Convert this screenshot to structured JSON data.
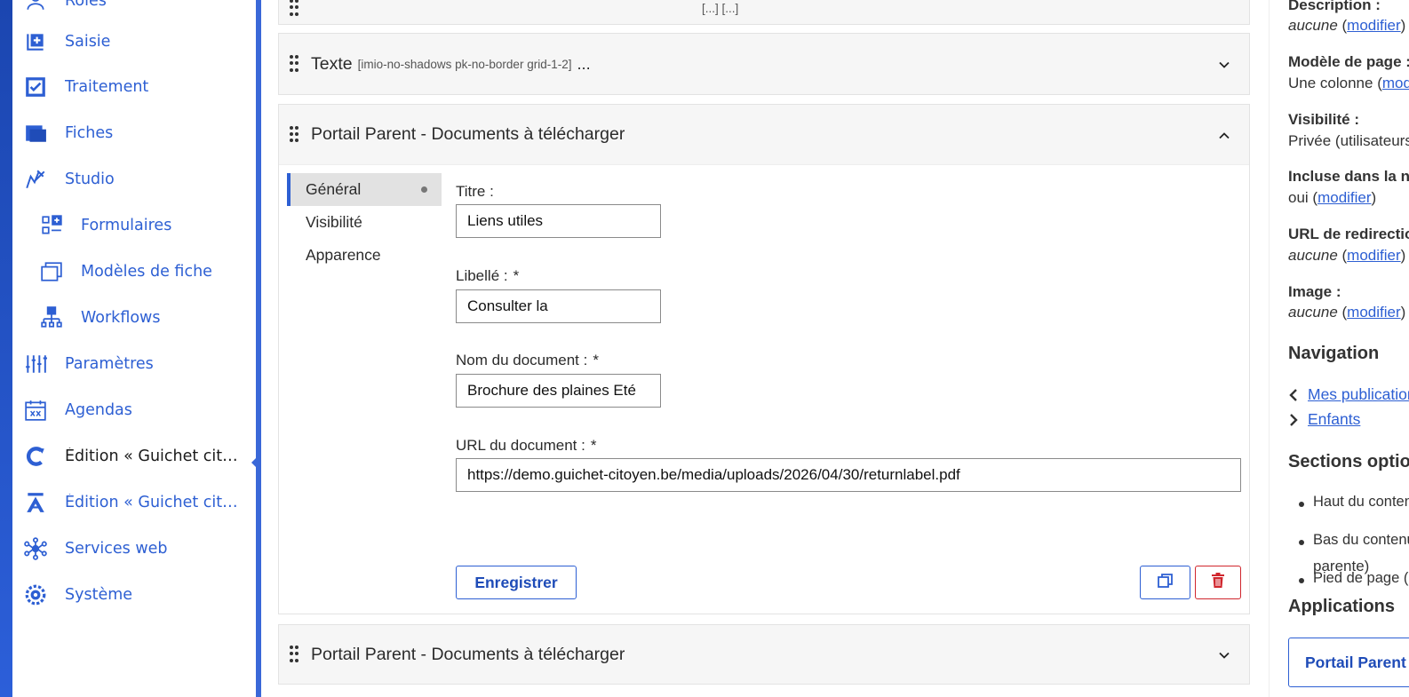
{
  "sidebar": {
    "items": [
      {
        "label": "Rôles",
        "icon": "users-icon"
      },
      {
        "label": "Saisie",
        "icon": "add-entry-icon"
      },
      {
        "label": "Traitement",
        "icon": "checkbox-icon"
      },
      {
        "label": "Fiches",
        "icon": "folder-icon"
      },
      {
        "label": "Studio",
        "icon": "studio-icon"
      },
      {
        "label": "Formulaires",
        "icon": "form-icon"
      },
      {
        "label": "Modèles de fiche",
        "icon": "card-template-icon"
      },
      {
        "label": "Workflows",
        "icon": "workflow-icon"
      },
      {
        "label": "Paramètres",
        "icon": "sliders-icon"
      },
      {
        "label": "Agendas",
        "icon": "calendar-icon"
      },
      {
        "label": "Édition « Guichet citoye...",
        "icon": "combo-c-icon"
      },
      {
        "label": "Édition « Guichet citoye...",
        "icon": "combo-a-icon"
      },
      {
        "label": "Services web",
        "icon": "network-icon"
      },
      {
        "label": "Système",
        "icon": "gear-icon"
      }
    ]
  },
  "main": {
    "cells": {
      "top_partial": {
        "title": "[...] [...]"
      },
      "texte": {
        "title": "Texte",
        "extra": "[imio-no-shadows pk-no-border grid-1-2]",
        "dots": "..."
      },
      "open": {
        "title": "Portail Parent - Documents à télécharger",
        "tabs": [
          "Général",
          "Visibilité",
          "Apparence"
        ],
        "fields": {
          "titre": {
            "label": "Titre :",
            "value": "Liens utiles"
          },
          "libelle": {
            "label": "Libellé :",
            "required": "*",
            "value": "Consulter la"
          },
          "nom": {
            "label": "Nom du document :",
            "required": "*",
            "value": "Brochure des plaines Eté"
          },
          "url": {
            "label": "URL du document :",
            "required": "*",
            "value": "https://demo.guichet-citoyen.be/media/uploads/2026/04/30/returnlabel.pdf"
          }
        },
        "save_label": "Enregistrer"
      },
      "bottom": {
        "title": "Portail Parent - Documents à télécharger"
      }
    }
  },
  "right": {
    "description": {
      "label": "Description :",
      "value": "aucune",
      "link": "modifier"
    },
    "modele": {
      "label": "Modèle de page :",
      "value": "Une colonne",
      "link": "modifier"
    },
    "visibilite": {
      "label": "Visibilité :",
      "value": "Privée (utilisateurs"
    },
    "incluse": {
      "label": "Incluse dans la navigation :",
      "value": "oui",
      "link": "modifier"
    },
    "url_redirect": {
      "label": "URL de redirection :",
      "value": "aucune",
      "link": "modifier"
    },
    "image": {
      "label": "Image :",
      "value": "aucune",
      "link": "modifier"
    },
    "navigation_title": "Navigation",
    "nav_links": [
      "Mes publications",
      "Enfants"
    ],
    "sections_title": "Sections optionnelles",
    "sections": [
      "Haut du contenu",
      "Bas du contenu",
      "Pied de page (de",
      "parente)"
    ],
    "applications_title": "Applications",
    "app_button": "Portail Parent"
  },
  "colors": {
    "accent": "#2d5fd3",
    "danger": "#d0262d",
    "sidebar_edge": "#1b46b0"
  }
}
